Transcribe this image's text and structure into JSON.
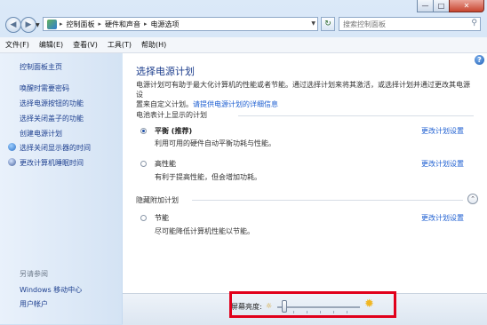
{
  "window": {
    "buttons": {
      "minimize": "—",
      "maximize": "□",
      "close": "✕"
    }
  },
  "nav": {
    "back_icon": "back-arrow-icon",
    "forward_icon": "forward-arrow-icon",
    "breadcrumb": [
      "控制面板",
      "硬件和声音",
      "电源选项"
    ],
    "separator": "▸",
    "search_placeholder": "搜索控制面板"
  },
  "menu": [
    "文件(F)",
    "编辑(E)",
    "查看(V)",
    "工具(T)",
    "帮助(H)"
  ],
  "sidebar": {
    "items": [
      "控制面板主页",
      "唤醒时需要密码",
      "选择电源按钮的功能",
      "选择关闭盖子的功能",
      "创建电源计划",
      "选择关闭显示器的时间",
      "更改计算机睡眠时间"
    ],
    "see_also": "另请参阅",
    "see_also_items": [
      "Windows 移动中心",
      "用户帐户"
    ]
  },
  "main": {
    "title": "选择电源计划",
    "desc_line1": "电源计划可有助于最大化计算机的性能或者节能。通过选择计划来将其激活，或选择计划并通过更改其电源设",
    "desc_line2_prefix": "置来自定义计划。",
    "desc_link": "请提供电源计划的详细信息",
    "section_battery": "电池表计上显示的计划",
    "section_hidden": "隐藏附加计划",
    "change_link": "更改计划设置",
    "plans": [
      {
        "name": "平衡 (推荐)",
        "desc": "利用可用的硬件自动平衡功耗与性能。",
        "selected": true
      },
      {
        "name": "高性能",
        "desc": "有利于提高性能，但会增加功耗。",
        "selected": false
      },
      {
        "name": "节能",
        "desc": "尽可能降低计算机性能以节能。",
        "selected": false
      }
    ],
    "collapse_glyph": "⌃"
  },
  "brightness": {
    "label": "屏幕亮度:",
    "level_fraction": 0.05
  },
  "colors": {
    "link": "#1c5ed1",
    "title": "#1b3c8c",
    "highlight": "#e1001b"
  }
}
